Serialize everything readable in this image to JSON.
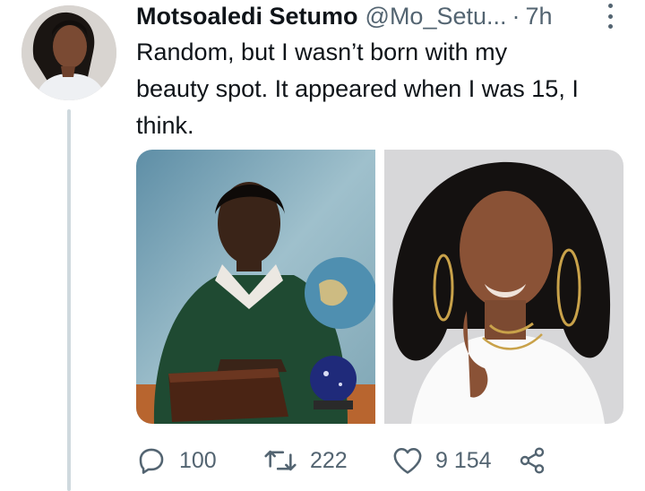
{
  "tweet": {
    "author": {
      "display_name": "Motsoaledi Setumo",
      "handle": "@Mo_Setu...",
      "avatar_icon": "profile-photo"
    },
    "separator": "·",
    "time": "7h",
    "text_lines": [
      "Random, but I wasn’t born with my",
      "beauty spot. It appeared when I was 15, I",
      "think."
    ],
    "media": [
      {
        "name": "school-photo",
        "icon": "photo"
      },
      {
        "name": "portrait-photo",
        "icon": "photo"
      }
    ],
    "actions": {
      "reply_count": "100",
      "retweet_count": "222",
      "like_count": "9 154"
    }
  },
  "colors": {
    "text": "#0f1419",
    "secondary": "#536471",
    "thread_line": "#cfd9de"
  }
}
